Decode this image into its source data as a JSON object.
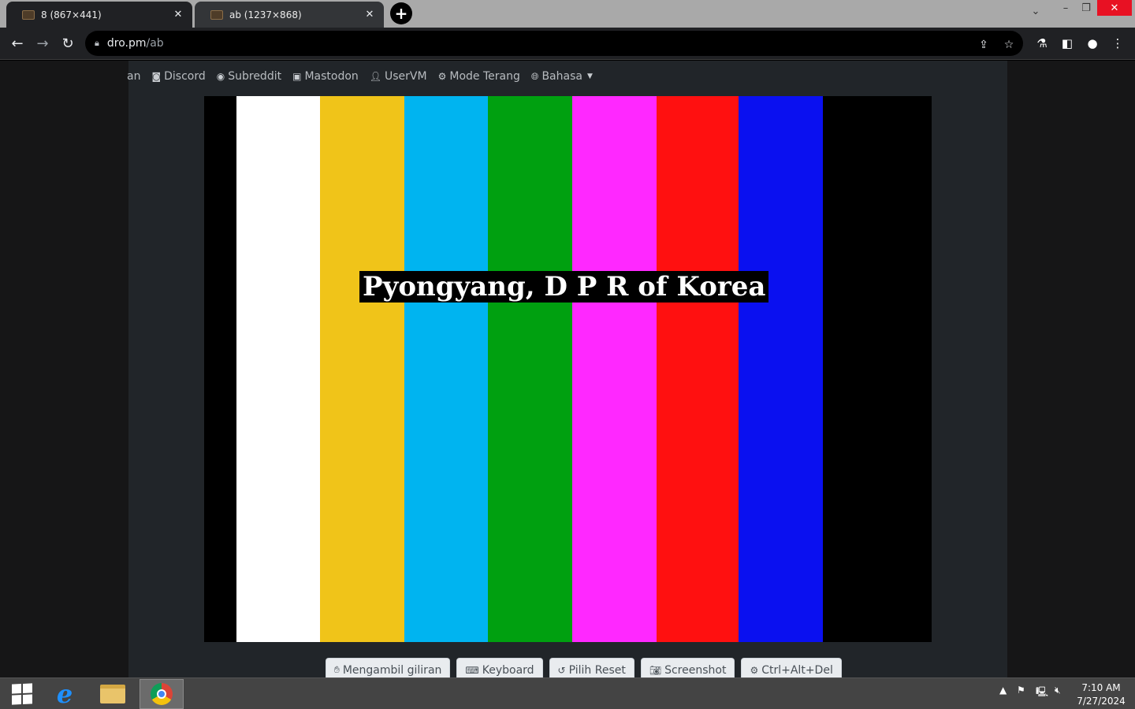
{
  "browser": {
    "tabs": [
      {
        "title": "8 (867×441)",
        "active": true
      },
      {
        "title": "ab (1237×868)",
        "active": false
      }
    ],
    "address": {
      "host": "dro.pm",
      "path": "/ab"
    }
  },
  "nav": {
    "items": [
      {
        "label": "an",
        "icon": ""
      },
      {
        "label": "Discord",
        "icon": "discord-icon"
      },
      {
        "label": "Subreddit",
        "icon": "reddit-icon"
      },
      {
        "label": "Mastodon",
        "icon": "mastodon-icon"
      },
      {
        "label": "UserVM",
        "icon": "user-icon"
      },
      {
        "label": "Mode Terang",
        "icon": "gear-icon"
      },
      {
        "label": "Bahasa",
        "icon": "globe-icon"
      }
    ]
  },
  "screen": {
    "caption": "Pyongyang, D P R of Korea",
    "bars": [
      "#ffffff",
      "#f0c419",
      "#00b4f0",
      "#00a010",
      "#ff28ff",
      "#ff1010",
      "#0a10f0"
    ]
  },
  "controls": [
    {
      "label": "Mengambil giliran",
      "icon": "hand-icon"
    },
    {
      "label": "Keyboard",
      "icon": "keyboard-icon"
    },
    {
      "label": "Pilih Reset",
      "icon": "reset-icon"
    },
    {
      "label": "Screenshot",
      "icon": "camera-icon"
    },
    {
      "label": "Ctrl+Alt+Del",
      "icon": "gear-icon"
    }
  ],
  "taskbar": {
    "time": "7:10 AM",
    "date": "7/27/2024"
  }
}
